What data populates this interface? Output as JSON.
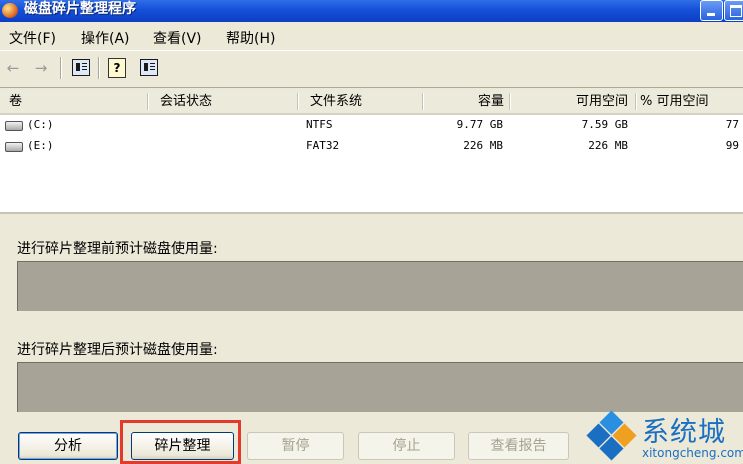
{
  "window": {
    "title": "磁盘碎片整理程序"
  },
  "menu": [
    "文件(F)",
    "操作(A)",
    "查看(V)",
    "帮助(H)"
  ],
  "toolbar": {
    "back_icon": "back-arrow-icon",
    "forward_icon": "forward-arrow-icon",
    "help_glyph": "?"
  },
  "table": {
    "headers": [
      "卷",
      "会话状态",
      "文件系统",
      "容量",
      "可用空间",
      "% 可用空间"
    ],
    "rows": [
      {
        "volume": "(C:)",
        "status": "",
        "fs": "NTFS",
        "capacity": "9.77 GB",
        "free": "7.59 GB",
        "pct": "77"
      },
      {
        "volume": "(E:)",
        "status": "",
        "fs": "FAT32",
        "capacity": "226 MB",
        "free": "226 MB",
        "pct": "99"
      }
    ]
  },
  "before": {
    "label": "进行碎片整理前预计磁盘使用量:"
  },
  "after": {
    "label": "进行碎片整理后预计磁盘使用量:"
  },
  "buttons": {
    "analyze": "分析",
    "defrag": "碎片整理",
    "pause": "暂停",
    "stop": "停止",
    "report": "查看报告"
  },
  "watermark": {
    "name": "系统城",
    "url": "xitongcheng.com"
  },
  "colors": {
    "title_bar": "#1450d8",
    "highlight": "#e23b2e",
    "usage_bar": "#a7a497",
    "watermark": "#1a6fc2"
  }
}
